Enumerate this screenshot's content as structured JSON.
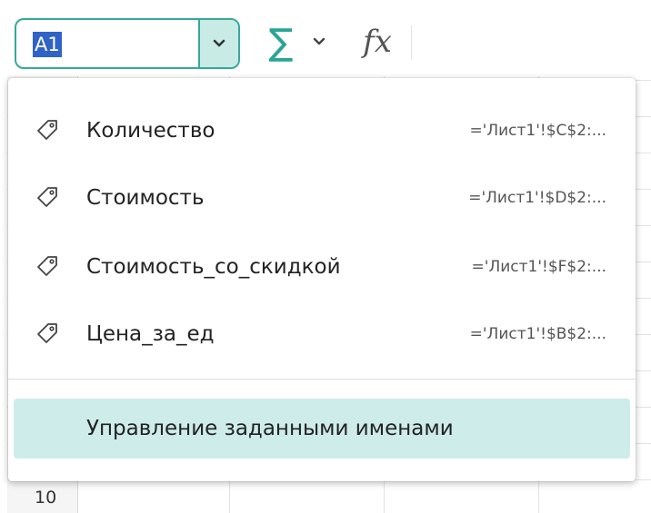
{
  "toolbar": {
    "namebox_value": "A1",
    "sum_symbol": "∑",
    "fx_label": "fx",
    "accent_color": "#35a99a",
    "sum_color": "#2aa595",
    "selection_color": "#2f63c7"
  },
  "grid": {
    "visible_row_number": "10"
  },
  "names_menu": {
    "items": [
      {
        "name": "Количество",
        "ref": "='Лист1'!$C$2:...",
        "icon": "tag-icon"
      },
      {
        "name": "Стоимость",
        "ref": "='Лист1'!$D$2:...",
        "icon": "tag-icon"
      },
      {
        "name": "Стоимость_со_скидкой",
        "ref": "='Лист1'!$F$2:...",
        "icon": "tag-icon"
      },
      {
        "name": "Цена_за_ед",
        "ref": "='Лист1'!$B$2:...",
        "icon": "tag-icon"
      }
    ],
    "manage_label": "Управление заданными именами",
    "manage_highlight_color": "#cdecea"
  }
}
